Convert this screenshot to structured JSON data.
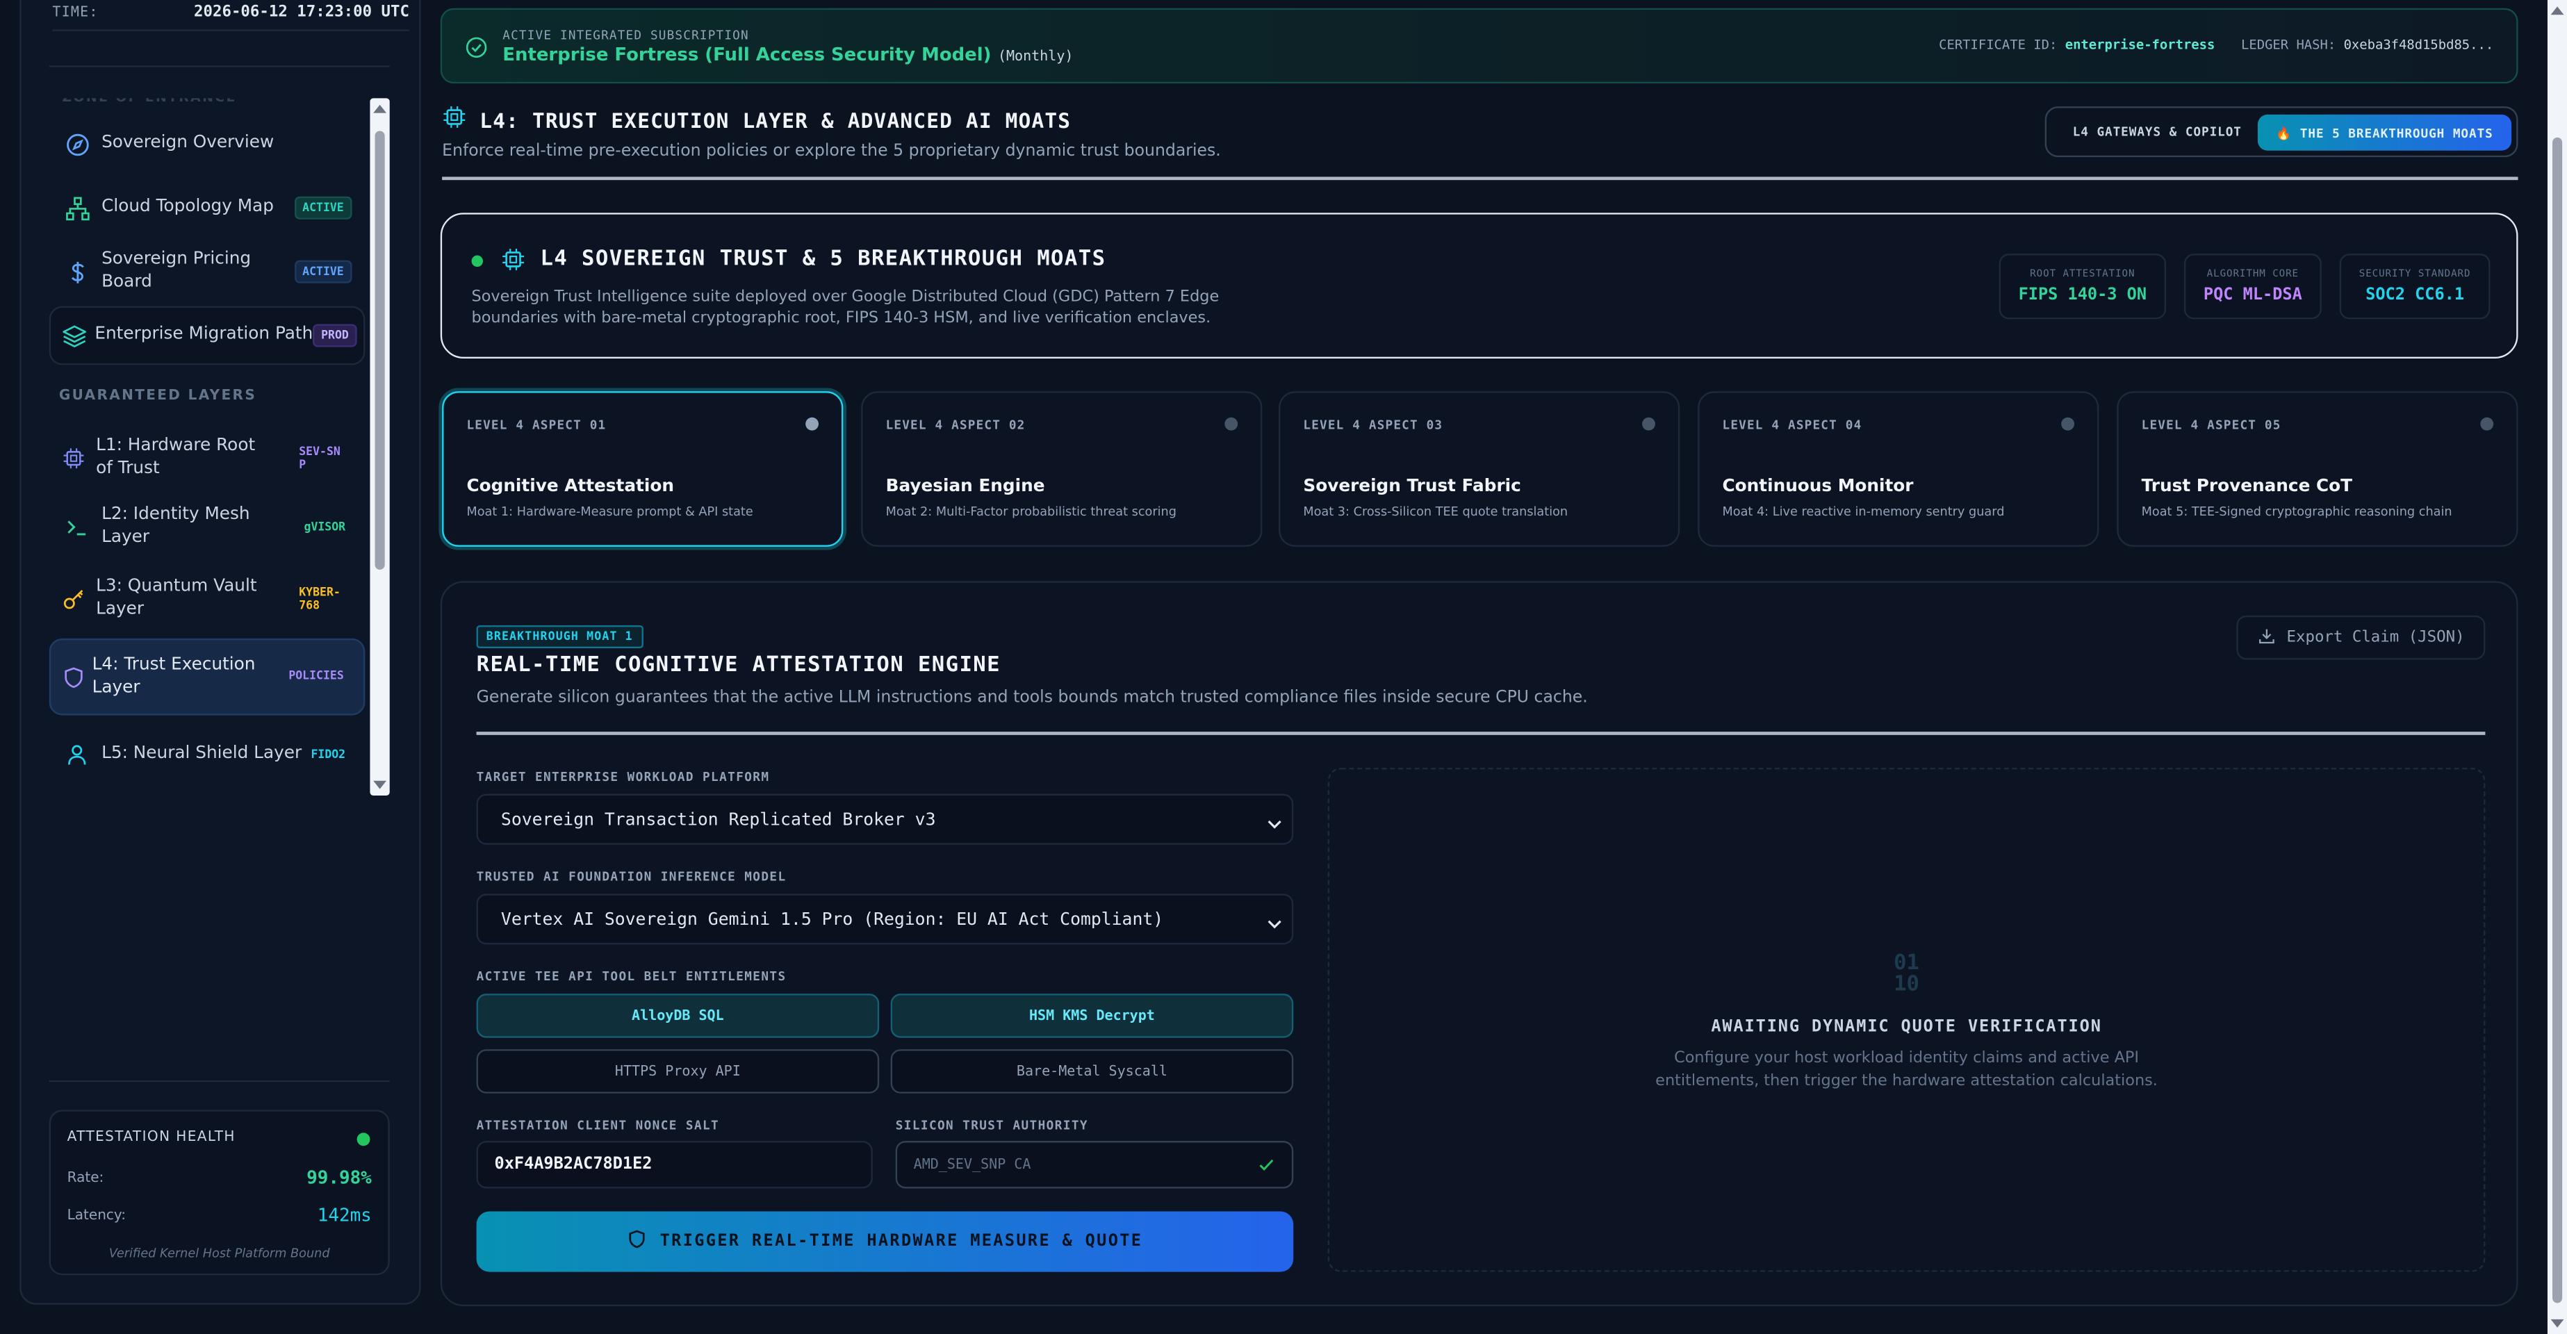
{
  "sidebar": {
    "time_label": "TIME:",
    "time_value": "2026-06-12 17:23:00 UTC",
    "cut_heading": "ZONE OF ENTRANCE",
    "items": [
      {
        "label": "Sovereign Overview",
        "badge": ""
      },
      {
        "label": "Cloud Topology Map",
        "badge": "ACTIVE"
      },
      {
        "label": "Sovereign Pricing Board",
        "badge": "ACTIVE"
      },
      {
        "label": "Enterprise Migration Path",
        "badge": "PROD"
      }
    ],
    "layers_heading": "GUARANTEED LAYERS",
    "layers": [
      {
        "label": "L1: Hardware Root of Trust",
        "badge": "SEV-SNP"
      },
      {
        "label": "L2: Identity Mesh Layer",
        "badge": "gVISOR"
      },
      {
        "label": "L3: Quantum Vault Layer",
        "badge": "KYBER-768"
      },
      {
        "label": "L4: Trust Execution Layer",
        "badge": "POLICIES"
      },
      {
        "label": "L5: Neural Shield Layer",
        "badge": "FIDO2"
      }
    ],
    "health": {
      "title": "ATTESTATION HEALTH",
      "rate_label": "Rate:",
      "rate_value": "99.98%",
      "latency_label": "Latency:",
      "latency_value": "142ms",
      "footer": "Verified Kernel Host Platform Bound"
    }
  },
  "subscription": {
    "kicker": "ACTIVE INTEGRATED SUBSCRIPTION",
    "title": "Enterprise Fortress (Full Access Security Model)",
    "period": "(Monthly)",
    "cert_label": "CERTIFICATE ID:",
    "cert_value": "enterprise-fortress",
    "ledger_label": "LEDGER HASH:",
    "ledger_value": "0xeba3f48d15bd85..."
  },
  "header": {
    "title": "L4: TRUST EXECUTION LAYER & ADVANCED AI MOATS",
    "subtitle": "Enforce real-time pre-execution policies or explore the 5 proprietary dynamic trust boundaries.",
    "toggle_a": "L4 GATEWAYS & COPILOT",
    "toggle_b": "🔥 THE 5 BREAKTHROUGH MOATS"
  },
  "hero": {
    "title": "L4 SOVEREIGN TRUST & 5 BREAKTHROUGH MOATS",
    "description": "Sovereign Trust Intelligence suite deployed over Google Distributed Cloud (GDC) Pattern 7 Edge boundaries with bare-metal cryptographic root, FIPS 140-3 HSM, and live verification enclaves.",
    "metrics": [
      {
        "key": "ROOT ATTESTATION",
        "value": "FIPS 140-3 ON",
        "color": "#34d399"
      },
      {
        "key": "ALGORITHM CORE",
        "value": "PQC ML-DSA",
        "color": "#c084fc"
      },
      {
        "key": "SECURITY STANDARD",
        "value": "SOC2 CC6.1",
        "color": "#22d3ee"
      }
    ]
  },
  "aspects": [
    {
      "kicker": "LEVEL 4 ASPECT 01",
      "title": "Cognitive Attestation",
      "sub": "Moat 1: Hardware-Measure prompt & API state"
    },
    {
      "kicker": "LEVEL 4 ASPECT 02",
      "title": "Bayesian Engine",
      "sub": "Moat 2: Multi-Factor probabilistic threat scoring"
    },
    {
      "kicker": "LEVEL 4 ASPECT 03",
      "title": "Sovereign Trust Fabric",
      "sub": "Moat 3: Cross-Silicon TEE quote translation"
    },
    {
      "kicker": "LEVEL 4 ASPECT 04",
      "title": "Continuous Monitor",
      "sub": "Moat 4: Live reactive in-memory sentry guard"
    },
    {
      "kicker": "LEVEL 4 ASPECT 05",
      "title": "Trust Provenance CoT",
      "sub": "Moat 5: TEE-Signed cryptographic reasoning chain"
    }
  ],
  "panel": {
    "tag": "BREAKTHROUGH MOAT 1",
    "title": "REAL-TIME COGNITIVE ATTESTATION ENGINE",
    "subtitle": "Generate silicon guarantees that the active LLM instructions and tools bounds match trusted compliance files inside secure CPU cache.",
    "export_label": "Export Claim (JSON)",
    "platform_label": "TARGET ENTERPRISE WORKLOAD PLATFORM",
    "platform_value": "Sovereign Transaction Replicated Broker v3",
    "model_label": "TRUSTED AI FOUNDATION INFERENCE MODEL",
    "model_value": "Vertex AI Sovereign Gemini 1.5 Pro (Region: EU AI Act Compliant)",
    "tools_label": "ACTIVE TEE API TOOL BELT ENTITLEMENTS",
    "tools": [
      {
        "label": "AlloyDB SQL",
        "active": true
      },
      {
        "label": "HSM KMS Decrypt",
        "active": true
      },
      {
        "label": "HTTPS Proxy API",
        "active": false
      },
      {
        "label": "Bare-Metal Syscall",
        "active": false
      }
    ],
    "nonce_label": "ATTESTATION CLIENT NONCE SALT",
    "nonce_value": "0xF4A9B2AC78D1E2",
    "authority_label": "SILICON TRUST AUTHORITY",
    "authority_placeholder": "AMD_SEV_SNP CA",
    "trigger_label": "TRIGGER REAL-TIME HARDWARE MEASURE & QUOTE",
    "await_bin_1": "01",
    "await_bin_2": "10",
    "await_title": "AWAITING DYNAMIC QUOTE VERIFICATION",
    "await_desc": "Configure your host workload identity claims and active API entitlements, then trigger the hardware attestation calculations."
  }
}
